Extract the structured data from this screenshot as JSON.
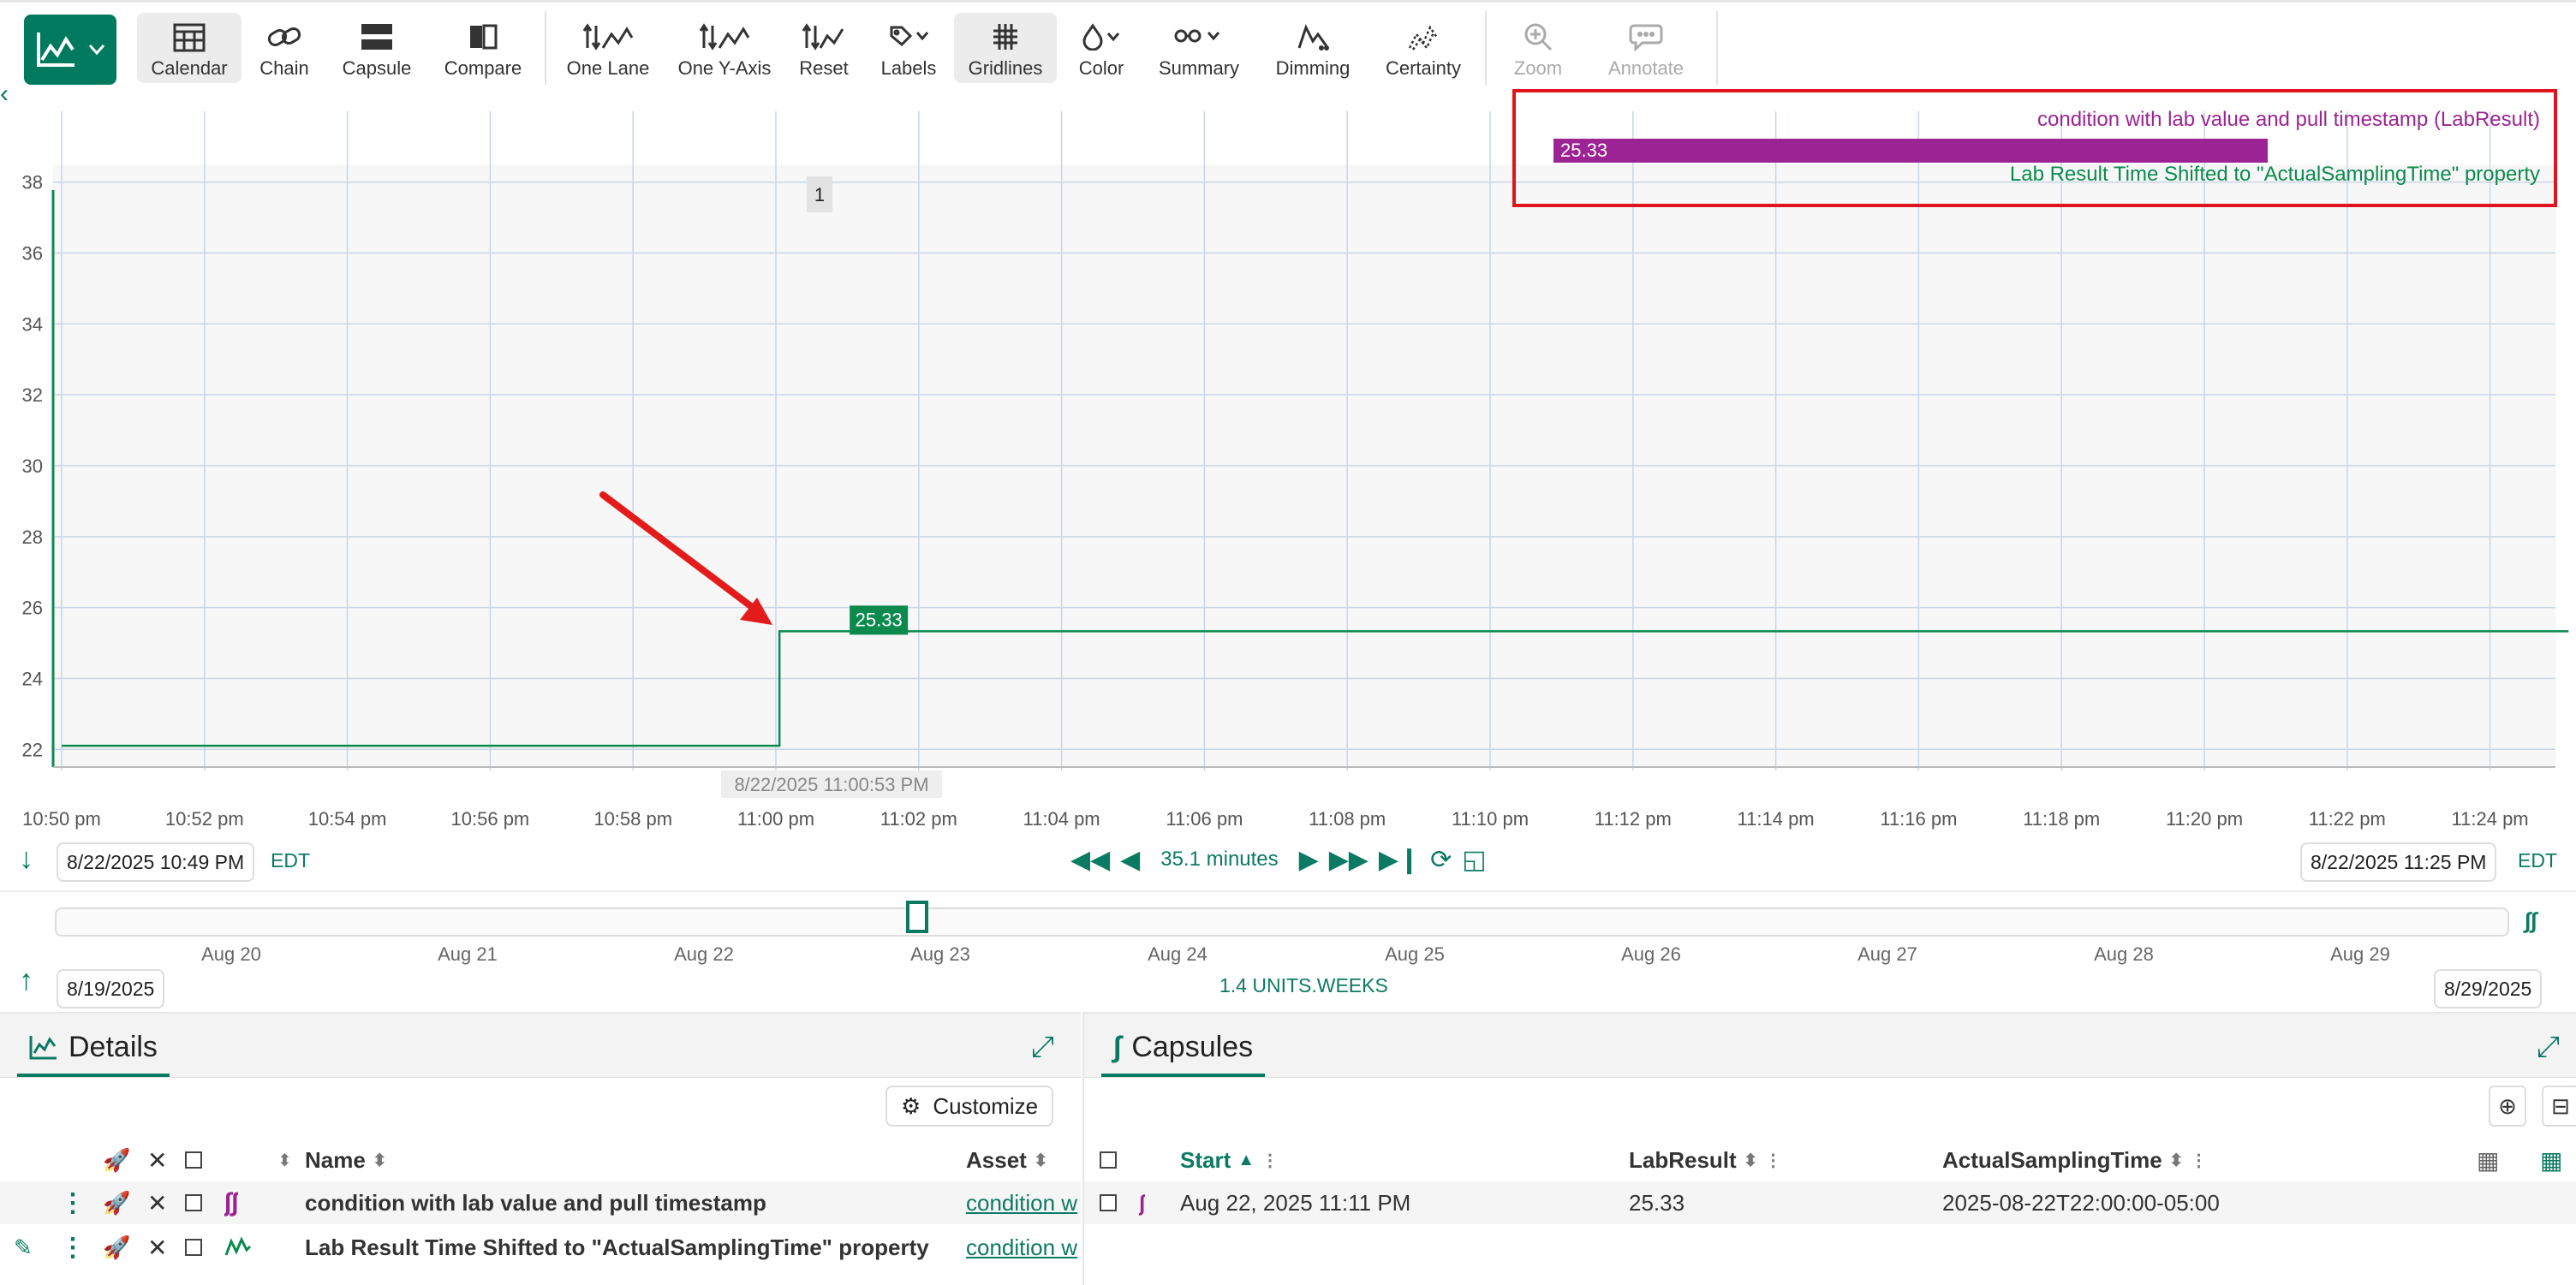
{
  "toolbar": {
    "items": [
      {
        "label": "Calendar",
        "icon": "calendar-icon"
      },
      {
        "label": "Chain",
        "icon": "chain-icon"
      },
      {
        "label": "Capsule",
        "icon": "capsule-icon"
      },
      {
        "label": "Compare",
        "icon": "compare-icon"
      },
      {
        "label": "One Lane",
        "icon": "one-lane-icon"
      },
      {
        "label": "One Y-Axis",
        "icon": "one-y-axis-icon"
      },
      {
        "label": "Reset",
        "icon": "reset-icon"
      },
      {
        "label": "Labels",
        "icon": "labels-icon"
      },
      {
        "label": "Gridlines",
        "icon": "gridlines-icon"
      },
      {
        "label": "Color",
        "icon": "color-icon"
      },
      {
        "label": "Summary",
        "icon": "summary-icon"
      },
      {
        "label": "Dimming",
        "icon": "dimming-icon"
      },
      {
        "label": "Certainty",
        "icon": "certainty-icon"
      },
      {
        "label": "Zoom",
        "icon": "zoom-icon"
      },
      {
        "label": "Annotate",
        "icon": "annotate-icon"
      }
    ]
  },
  "legend": {
    "condition_name": "condition with lab value and pull timestamp (LabResult)",
    "capsule_value": "25.33",
    "signal_name": "Lab Result Time Shifted to \"ActualSamplingTime\" property"
  },
  "chart_data": {
    "type": "line",
    "title": "",
    "x_ticks": [
      "10:50 pm",
      "10:52 pm",
      "10:54 pm",
      "10:56 pm",
      "10:58 pm",
      "11:00 pm",
      "11:02 pm",
      "11:04 pm",
      "11:06 pm",
      "11:08 pm",
      "11:10 pm",
      "11:12 pm",
      "11:14 pm",
      "11:16 pm",
      "11:18 pm",
      "11:20 pm",
      "11:22 pm",
      "11:24 pm"
    ],
    "y_ticks": [
      "22",
      "24",
      "26",
      "28",
      "30",
      "32",
      "34",
      "36",
      "38"
    ],
    "ylim": [
      21.5,
      38.5
    ],
    "xlim_minutes": [
      0,
      35.1
    ],
    "series": [
      {
        "color": "#0b8a4e",
        "step": true,
        "x_minutes": [
          0,
          10.05,
          10.05,
          35.1
        ],
        "values": [
          22.1,
          22.1,
          25.33,
          25.33
        ],
        "label_value": "25.33"
      }
    ],
    "cursor_label": "8/22/2025 11:00:53 PM",
    "capsule_lane_marker": "1",
    "grid": true,
    "colors": {
      "signal": "#0b8a4e",
      "condition": "#9b2393",
      "grid": "#c9d6e6"
    }
  },
  "timebar": {
    "start": "8/22/2025 10:49 PM",
    "end": "8/22/2025 11:25 PM",
    "timezone": "EDT",
    "duration": "35.1 minutes"
  },
  "overview": {
    "ticks": [
      "Aug 20",
      "Aug 21",
      "Aug 22",
      "Aug 23",
      "Aug 24",
      "Aug 25",
      "Aug 26",
      "Aug 27",
      "Aug 28",
      "Aug 29"
    ],
    "start": "8/19/2025",
    "end": "8/29/2025",
    "units": "1.4 UNITS.WEEKS"
  },
  "details": {
    "tab": "Details",
    "customize": "Customize",
    "columns": {
      "name": "Name",
      "asset": "Asset"
    },
    "rows": [
      {
        "name": "condition with lab value and pull timestamp",
        "asset": "condition w"
      },
      {
        "name": "Lab Result Time Shifted to \"ActualSamplingTime\" property",
        "asset": "condition w"
      }
    ]
  },
  "capsules": {
    "tab": "Capsules",
    "columns": {
      "start": "Start",
      "labresult": "LabResult",
      "actual": "ActualSamplingTime"
    },
    "rows": [
      {
        "start": "Aug 22, 2025 11:11 PM",
        "labresult": "25.33",
        "actual": "2025-08-22T22:00:00-05:00"
      }
    ]
  }
}
